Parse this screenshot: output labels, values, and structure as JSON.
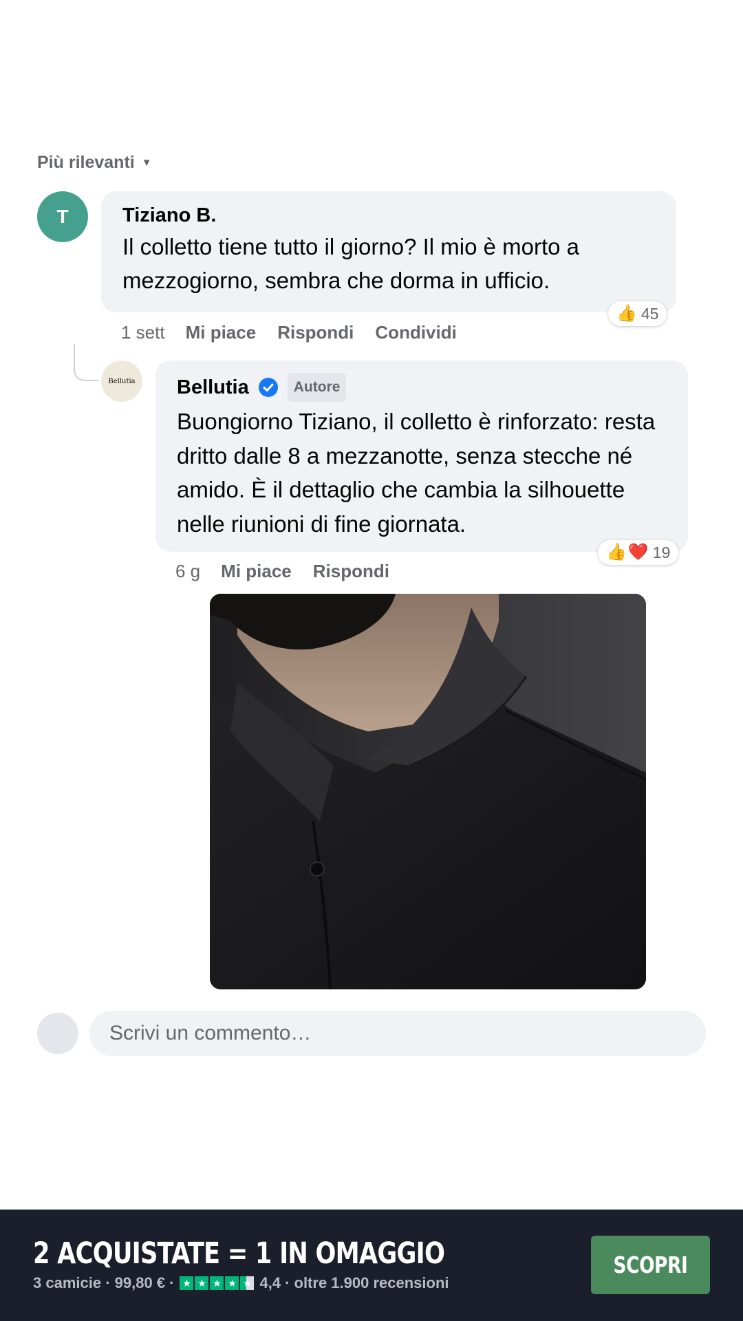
{
  "sort": {
    "label": "Più rilevanti"
  },
  "comments": [
    {
      "author": "Tiziano B.",
      "avatar_initial": "T",
      "text": "Il colletto tiene tutto il giorno? Il mio è morto a mezzogiorno, sembra che dorma in ufficio.",
      "time": "1 sett",
      "reaction_count": "45",
      "actions": {
        "like": "Mi piace",
        "reply": "Rispondi",
        "share": "Condividi"
      }
    },
    {
      "author": "Bellutia",
      "avatar_text": "Bellutia",
      "badge": "Autore",
      "text": "Buongiorno Tiziano, il colletto è rinforzato: resta dritto dalle 8 a mezzanotte, senza stecche né amido. È il dettaglio che cambia la silhouette nelle riunioni di fine giornata.",
      "time": "6 g",
      "reaction_count": "19",
      "actions": {
        "like": "Mi piace",
        "reply": "Rispondi"
      }
    }
  ],
  "composer": {
    "placeholder": "Scrivi un commento…"
  },
  "promo": {
    "headline": "2 ACQUISTATE = 1 IN OMAGGIO",
    "sub_left": "3 camicie · 99,80 € ·",
    "rating": "4,4",
    "sub_right": "· oltre 1.900 recensioni",
    "rating_value": 4.4,
    "cta": "SCOPRI"
  },
  "colors": {
    "avatar_t": "#45a08e",
    "verified": "#1877f2",
    "promo_bg": "#1b1e2b",
    "cta_bg": "#4a8a5c",
    "star": "#00b67a"
  },
  "icons": [
    "caret-down-icon",
    "verified-badge-icon",
    "thumbs-up-icon",
    "heart-icon",
    "star-icon"
  ]
}
